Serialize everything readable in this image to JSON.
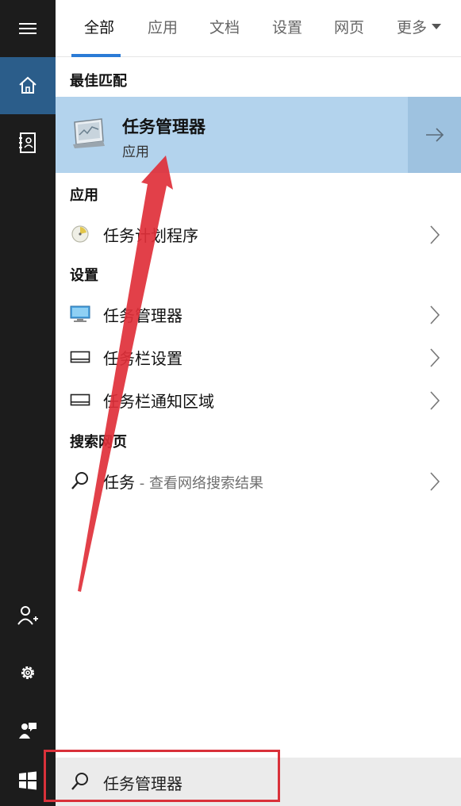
{
  "tabs": [
    {
      "label": "全部",
      "active": true
    },
    {
      "label": "应用",
      "active": false
    },
    {
      "label": "文档",
      "active": false
    },
    {
      "label": "设置",
      "active": false
    },
    {
      "label": "网页",
      "active": false
    },
    {
      "label": "更多",
      "active": false
    }
  ],
  "best_match": {
    "heading": "最佳匹配",
    "title": "任务管理器",
    "subtitle": "应用",
    "icon": "task-manager-icon"
  },
  "apps": {
    "heading": "应用",
    "items": [
      {
        "label": "任务计划程序",
        "icon": "task-scheduler-icon"
      }
    ]
  },
  "settings": {
    "heading": "设置",
    "items": [
      {
        "label": "任务管理器",
        "icon": "monitor-icon"
      },
      {
        "label": "任务栏设置",
        "icon": "taskbar-icon"
      },
      {
        "label": "任务栏通知区域",
        "icon": "taskbar-icon"
      }
    ]
  },
  "web": {
    "heading": "搜索网页",
    "items": [
      {
        "query": "任务",
        "suffix": " - 查看网络搜索结果",
        "icon": "search-icon"
      }
    ]
  },
  "search": {
    "value": "任务管理器"
  },
  "rail": [
    "menu-icon",
    "home-icon",
    "notebook-icon",
    "add-user-icon",
    "gear-icon",
    "feedback-icon",
    "windows-icon"
  ],
  "colors": {
    "rail_bg": "#1c1c1c",
    "rail_active": "#2b5d8a",
    "best_match_bg": "#b3d3ed",
    "tab_underline": "#2b7bd6",
    "annotation_red": "#d9313a"
  }
}
